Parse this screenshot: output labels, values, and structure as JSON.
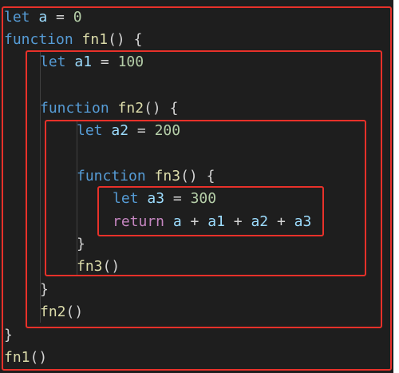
{
  "colors": {
    "background": "#1e1e1e",
    "keyword": "#569cd6",
    "control_keyword": "#c586c0",
    "function_name": "#dcdcaa",
    "variable": "#9cdcfe",
    "number": "#b5cea8",
    "plain": "#d4d4d4",
    "scope_outline": "#e8312a"
  },
  "code": {
    "l1": {
      "kw": "let",
      "var": "a",
      "op": " = ",
      "num": "0"
    },
    "l2": {
      "kw": "function",
      "fn": "fn1",
      "rest": "() {"
    },
    "l3": {
      "kw": "let",
      "var": "a1",
      "op": " = ",
      "num": "100"
    },
    "l5": {
      "kw": "function",
      "fn": "fn2",
      "rest": "() {"
    },
    "l6": {
      "kw": "let",
      "var": "a2",
      "op": " = ",
      "num": "200"
    },
    "l8": {
      "kw": "function",
      "fn": "fn3",
      "rest": "() {"
    },
    "l9": {
      "kw": "let",
      "var": "a3",
      "op": " = ",
      "num": "300"
    },
    "l10": {
      "kw": "return",
      "v1": "a",
      "p1": " + ",
      "v2": "a1",
      "p2": " + ",
      "v3": "a2",
      "p3": " + ",
      "v4": "a3"
    },
    "l11": {
      "rest": "}"
    },
    "l12": {
      "fn": "fn3",
      "rest": "()"
    },
    "l13": {
      "rest": "}"
    },
    "l14": {
      "fn": "fn2",
      "rest": "()"
    },
    "l15": {
      "rest": "}"
    },
    "l16": {
      "fn": "fn1",
      "rest": "()"
    }
  }
}
